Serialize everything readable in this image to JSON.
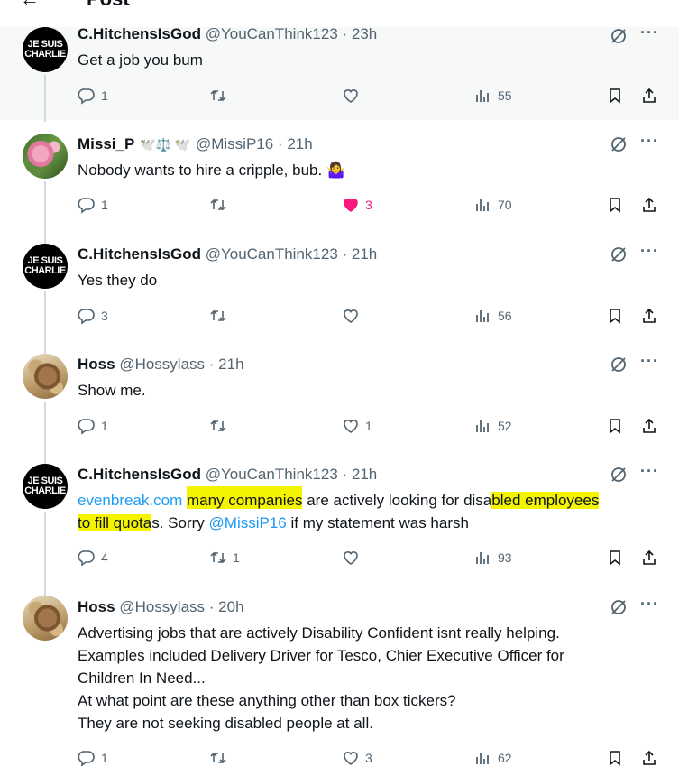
{
  "header": {
    "title": "Post"
  },
  "tweets": [
    {
      "name": "C.HitchensIsGod",
      "handle": "@YouCanThink123",
      "time": "23h",
      "text": "Get a job you bum",
      "replies": "1",
      "retweets": "",
      "likes": "",
      "views": "55",
      "avatar": {
        "line1": "JE SUIS",
        "line2": "CHARLIE"
      }
    },
    {
      "name": "Missi_P",
      "name_emoji": "🕊️⚖️ 🕊️",
      "handle": "@MissiP16",
      "time": "21h",
      "text": "Nobody wants to hire a cripple, bub.",
      "text_emoji": "🤷‍♀️",
      "replies": "1",
      "retweets": "",
      "likes": "3",
      "views": "70"
    },
    {
      "name": "C.HitchensIsGod",
      "handle": "@YouCanThink123",
      "time": "21h",
      "text": "Yes they do",
      "replies": "3",
      "retweets": "",
      "likes": "",
      "views": "56",
      "avatar": {
        "line1": "JE SUIS",
        "line2": "CHARLIE"
      }
    },
    {
      "name": "Hoss",
      "handle": "@Hossylass",
      "time": "21h",
      "text": "Show me.",
      "replies": "1",
      "retweets": "",
      "likes": "1",
      "views": "52"
    },
    {
      "name": "C.HitchensIsGod",
      "handle": "@YouCanThink123",
      "time": "21h",
      "link": "evenbreak.com",
      "text_hl_a": "many companies",
      "text_mid": " are actively looking for disa",
      "text_hl_b": "bled employees",
      "text_hl_c": "to fill quota",
      "text_after": "s. Sorry ",
      "mention": "@MissiP16",
      "text_end": " if my statement was harsh",
      "replies": "4",
      "retweets": "1",
      "likes": "",
      "views": "93",
      "avatar": {
        "line1": "JE SUIS",
        "line2": "CHARLIE"
      }
    },
    {
      "name": "Hoss",
      "handle": "@Hossylass",
      "time": "20h",
      "text": "Advertising jobs that are actively Disability Confident isnt really helping.\nExamples included Delivery Driver for Tesco, Chier Executive Officer for\nChildren In Need...\nAt what point are these anything other than box tickers?\nThey are not seeking disabled people at all.",
      "replies": "1",
      "retweets": "",
      "likes": "3",
      "views": "62"
    }
  ],
  "colors": {
    "accent": "#1d9bf0",
    "like": "#f91880",
    "muted": "#536471",
    "highlight": "#f4f400"
  },
  "icons": [
    "back-arrow-icon",
    "grok-icon",
    "more-icon",
    "reply-icon",
    "retweet-icon",
    "like-icon",
    "views-icon",
    "bookmark-icon",
    "share-icon"
  ]
}
